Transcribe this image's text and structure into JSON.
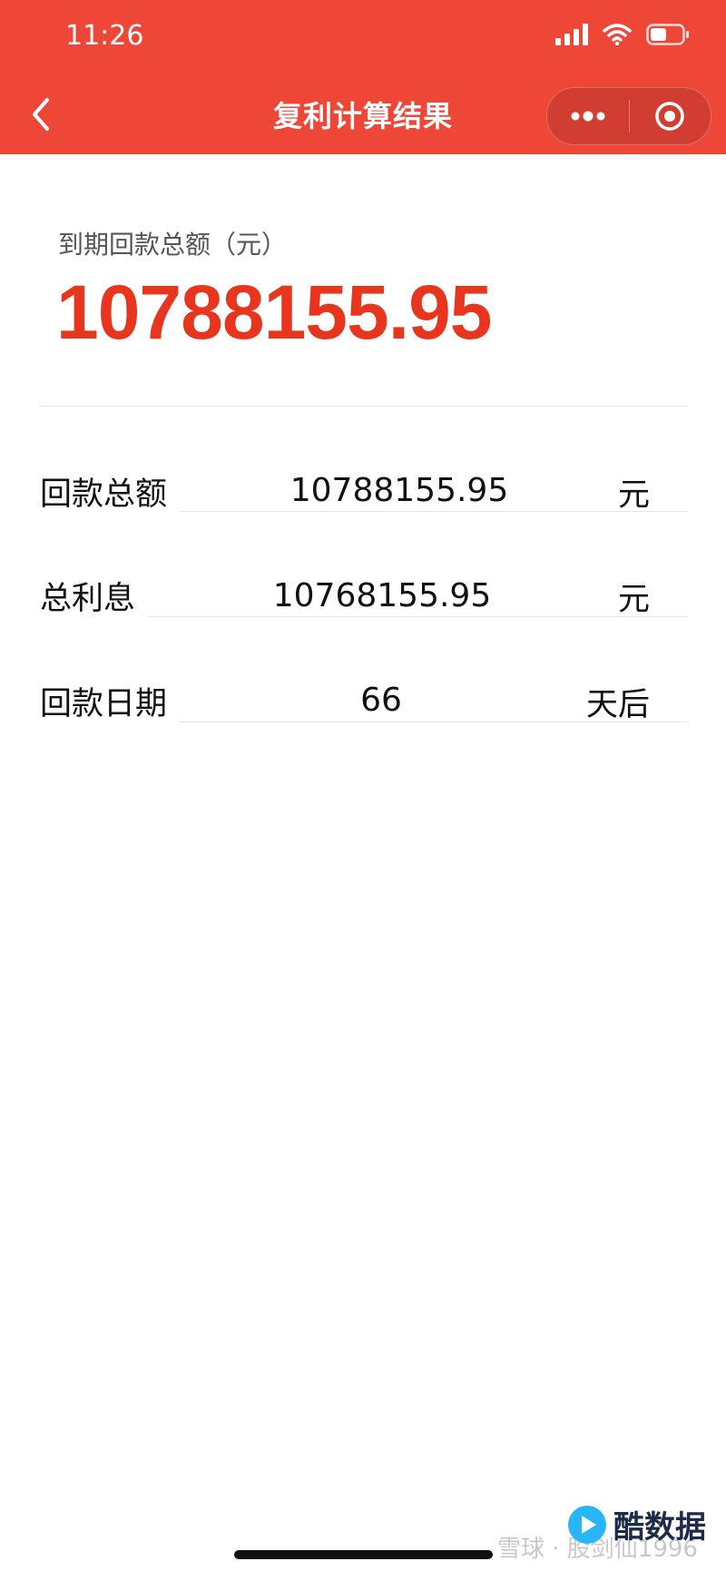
{
  "status_bar": {
    "time": "11:26"
  },
  "nav": {
    "title": "复利计算结果"
  },
  "summary": {
    "label": "到期回款总额（元）",
    "value": "10788155.95"
  },
  "rows": [
    {
      "label": "回款总额",
      "value": "10788155.95",
      "unit": "元"
    },
    {
      "label": "总利息",
      "value": "10768155.95",
      "unit": "元"
    },
    {
      "label": "回款日期",
      "value": "66",
      "unit": "天后"
    }
  ],
  "watermark": {
    "left": "雪球 · 股剑仙1996",
    "right": "酷数据"
  },
  "colors": {
    "header": "#ee4738",
    "accent": "#e8361e"
  }
}
